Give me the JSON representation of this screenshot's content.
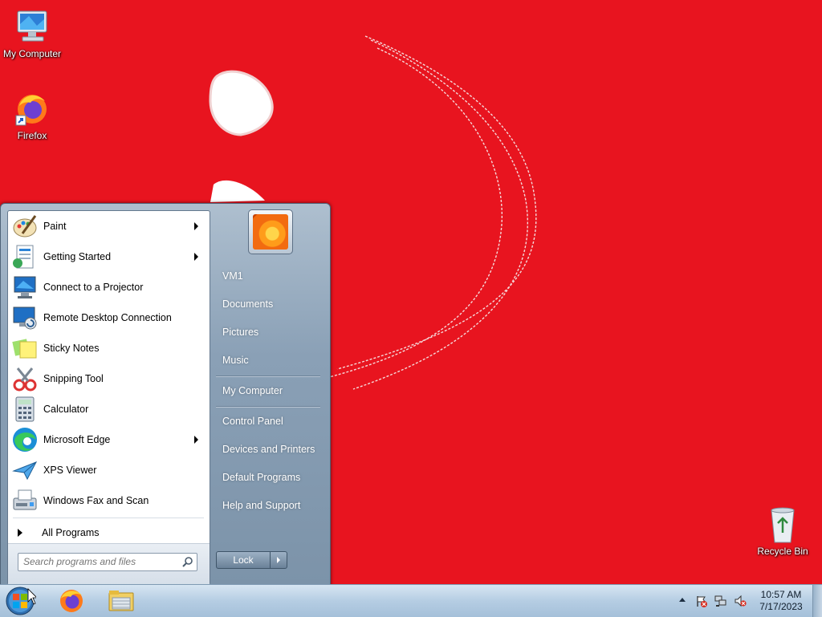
{
  "desktop": {
    "icons": [
      {
        "label": "My Computer"
      },
      {
        "label": "Firefox"
      },
      {
        "label": "Recycle Bin"
      }
    ]
  },
  "start_menu": {
    "programs": [
      {
        "label": "Paint",
        "icon": "paint-icon",
        "has_submenu": true
      },
      {
        "label": "Getting Started",
        "icon": "getting-started-icon",
        "has_submenu": true
      },
      {
        "label": "Connect to a Projector",
        "icon": "projector-icon",
        "has_submenu": false
      },
      {
        "label": "Remote Desktop Connection",
        "icon": "remote-desktop-icon",
        "has_submenu": false
      },
      {
        "label": "Sticky Notes",
        "icon": "sticky-notes-icon",
        "has_submenu": false
      },
      {
        "label": "Snipping Tool",
        "icon": "snipping-tool-icon",
        "has_submenu": false
      },
      {
        "label": "Calculator",
        "icon": "calculator-icon",
        "has_submenu": false
      },
      {
        "label": "Microsoft Edge",
        "icon": "edge-icon",
        "has_submenu": true
      },
      {
        "label": "XPS Viewer",
        "icon": "xps-viewer-icon",
        "has_submenu": false
      },
      {
        "label": "Windows Fax and Scan",
        "icon": "fax-scan-icon",
        "has_submenu": false
      }
    ],
    "all_programs": "All Programs",
    "search_placeholder": "Search programs and files",
    "right_items": [
      "VM1",
      "Documents",
      "Pictures",
      "Music",
      "My Computer",
      "Control Panel",
      "Devices and Printers",
      "Default Programs",
      "Help and Support"
    ],
    "lock_label": "Lock"
  },
  "taskbar": {
    "pinned": [
      "firefox-icon",
      "file-explorer-icon"
    ],
    "tray_icons": [
      "action-center-flag-icon",
      "network-icon",
      "volume-muted-icon"
    ],
    "time": "10:57 AM",
    "date": "7/17/2023"
  },
  "colors": {
    "wallpaper": "#e8141f",
    "start_menu_right": "#8aa0b6",
    "taskbar": "#b5cde3"
  }
}
